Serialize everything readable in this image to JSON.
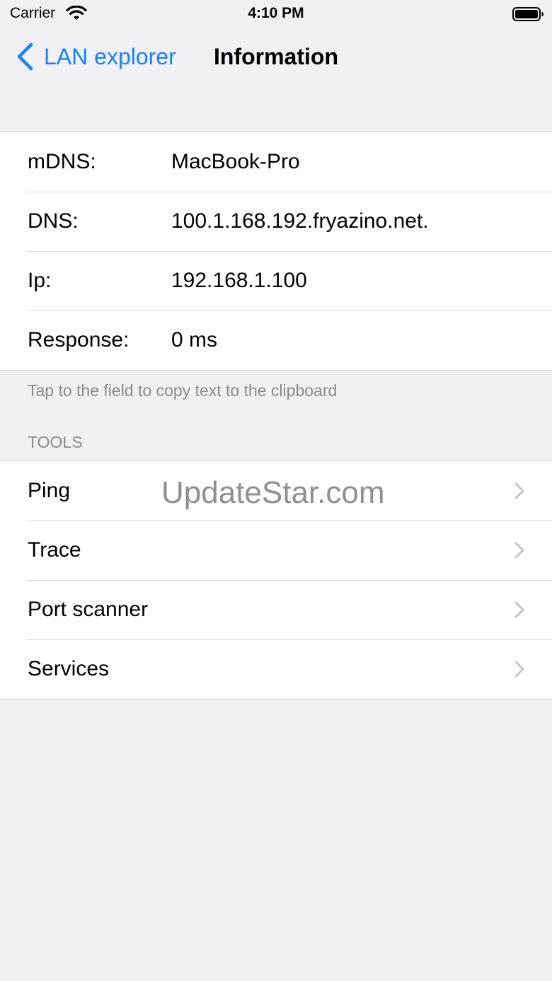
{
  "status_bar": {
    "carrier": "Carrier",
    "time": "4:10 PM"
  },
  "nav": {
    "back_label": "LAN explorer",
    "title": "Information"
  },
  "info_rows": [
    {
      "label": "mDNS:",
      "value": "MacBook-Pro"
    },
    {
      "label": "DNS:",
      "value": "100.1.168.192.fryazino.net."
    },
    {
      "label": "Ip:",
      "value": "192.168.1.100"
    },
    {
      "label": "Response:",
      "value": "0 ms"
    }
  ],
  "info_footer": "Tap to the field to copy text to the clipboard",
  "tools": {
    "header": "TOOLS",
    "items": [
      {
        "label": "Ping"
      },
      {
        "label": "Trace"
      },
      {
        "label": "Port scanner"
      },
      {
        "label": "Services"
      }
    ]
  },
  "watermark": "UpdateStar.com",
  "colors": {
    "accent": "#1a82f6",
    "background": "#f0f0f5",
    "secondary_text": "#8a8a8f"
  }
}
